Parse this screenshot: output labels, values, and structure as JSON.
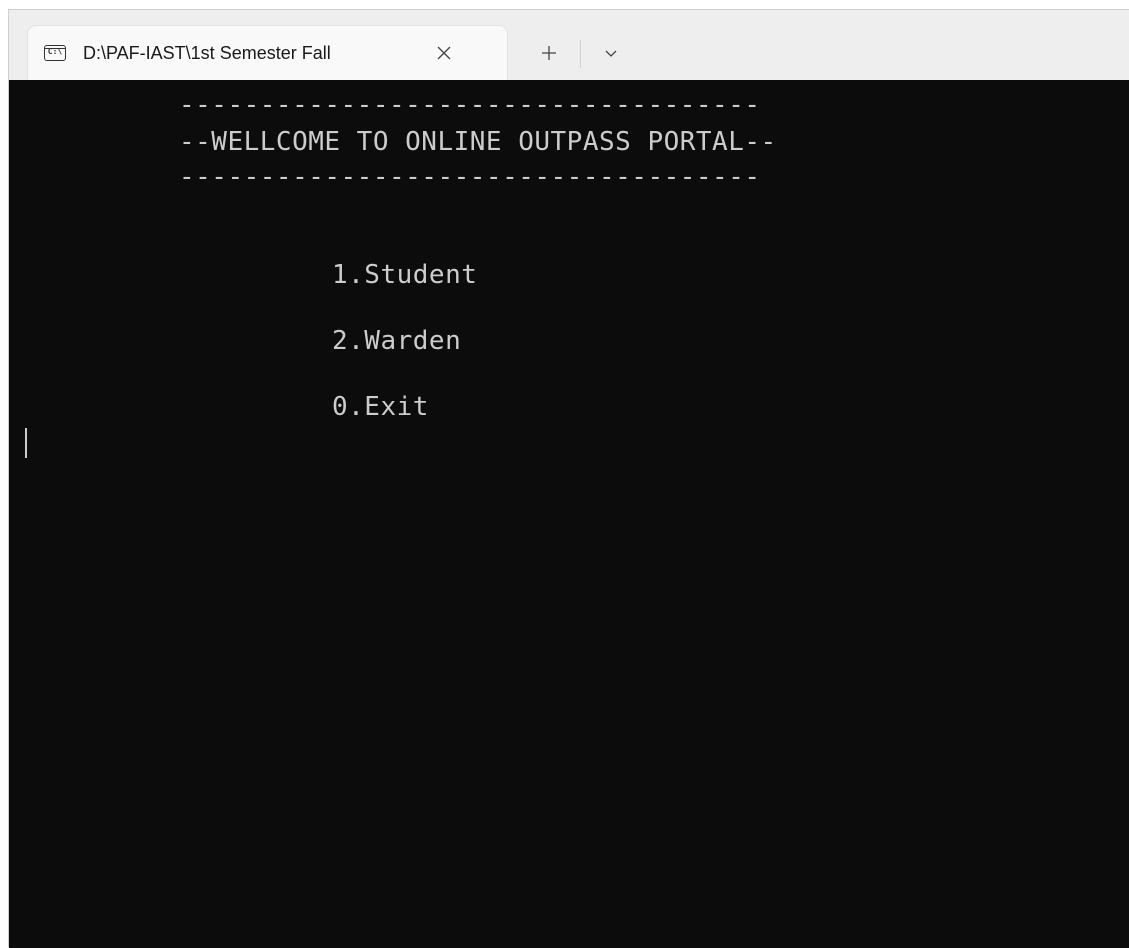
{
  "tab": {
    "title": "D:\\PAF-IAST\\1st Semester Fall",
    "icon": "console-icon",
    "icon_text": "C:\\"
  },
  "icons": {
    "close": "close-icon",
    "new_tab": "plus-icon",
    "dropdown": "chevron-down-icon"
  },
  "terminal": {
    "background": "#0c0c0c",
    "foreground": "#cccccc",
    "separator_top": "------------------------------------",
    "welcome": "--WELLCOME TO ONLINE OUTPASS PORTAL--",
    "separator_bottom": "------------------------------------",
    "menu": [
      "1.Student",
      "2.Warden",
      "0.Exit"
    ]
  }
}
